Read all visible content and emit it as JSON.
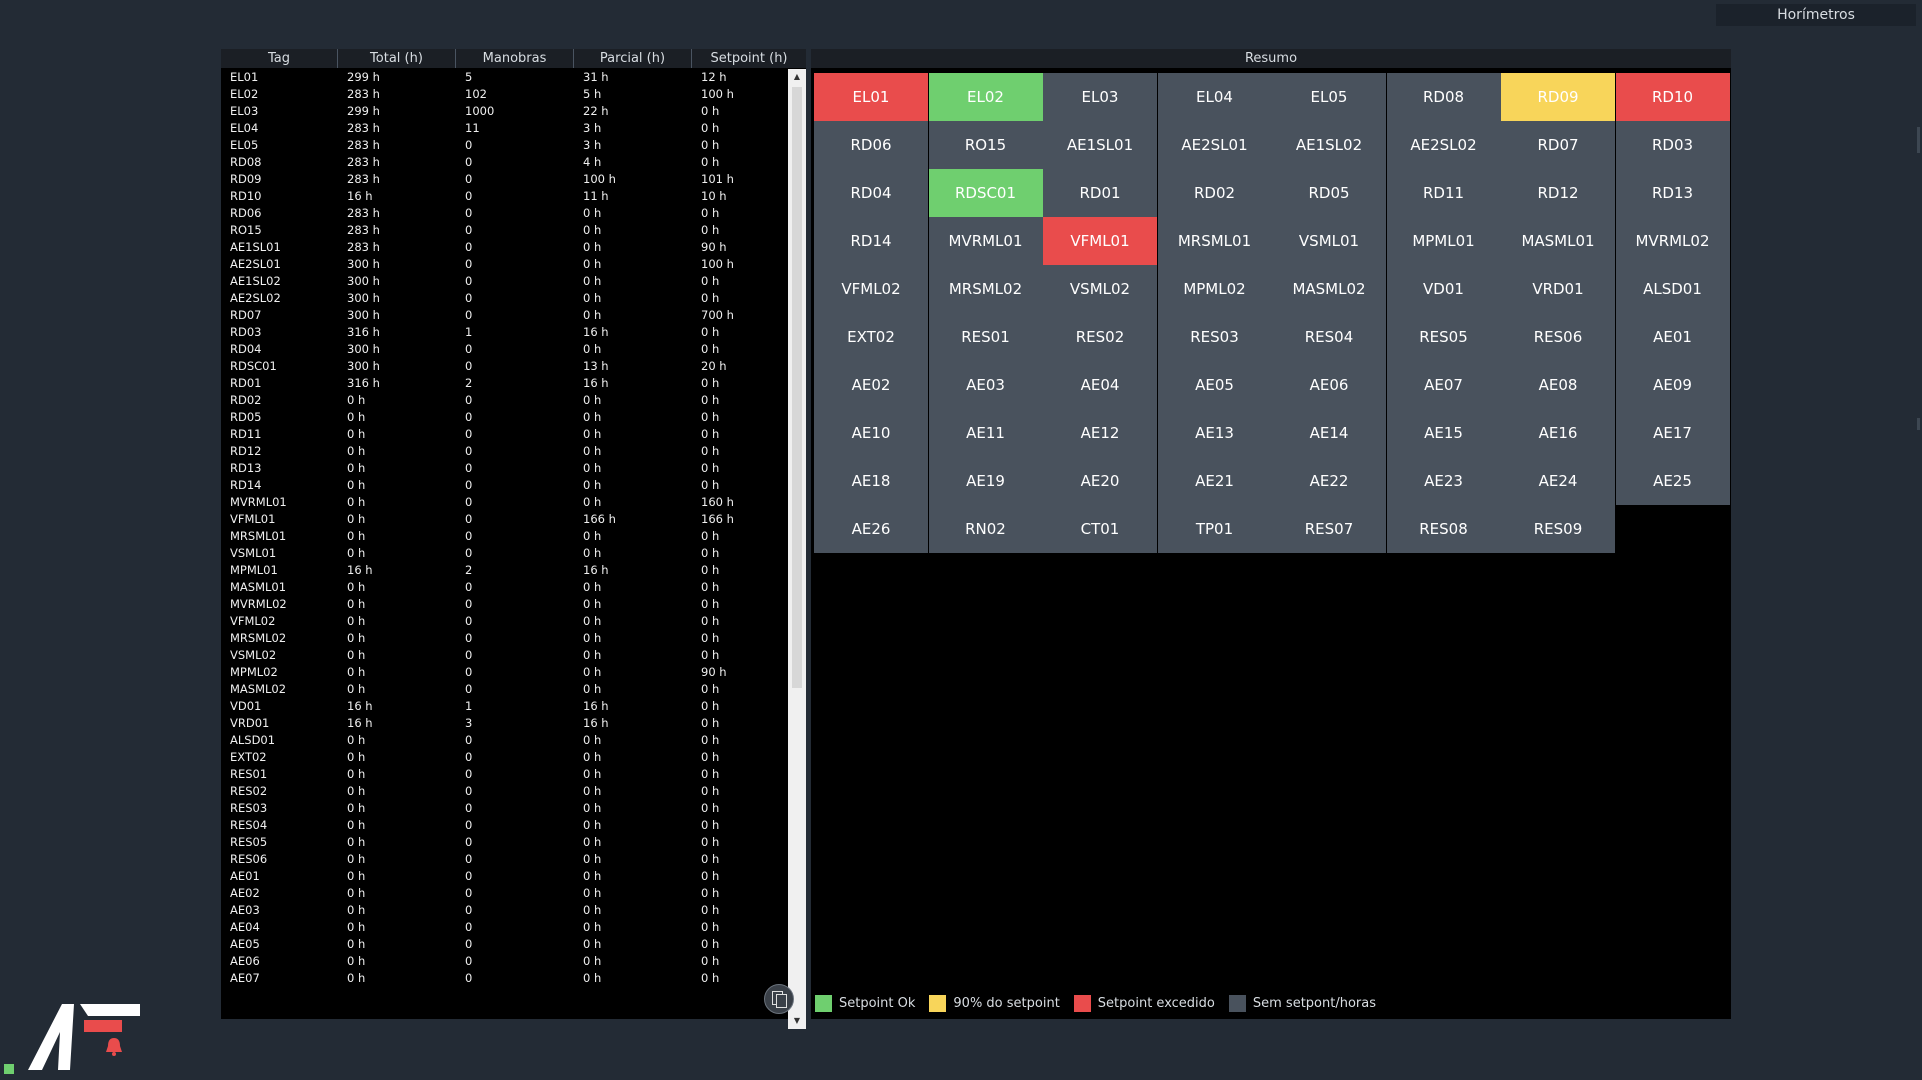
{
  "window": {
    "title": "Horímetros"
  },
  "colors": {
    "ok": "#6fcf6f",
    "warn": "#f8d55a",
    "exceeded": "#e94c4c",
    "none": "#49525d"
  },
  "table": {
    "headers": [
      "Tag",
      "Total (h)",
      "Manobras",
      "Parcial (h)",
      "Setpoint (h)"
    ],
    "rows": [
      [
        "EL01",
        "299 h",
        "5",
        "31 h",
        "12 h"
      ],
      [
        "EL02",
        "283 h",
        "102",
        "5 h",
        "100 h"
      ],
      [
        "EL03",
        "299 h",
        "1000",
        "22 h",
        "0 h"
      ],
      [
        "EL04",
        "283 h",
        "11",
        "3 h",
        "0 h"
      ],
      [
        "EL05",
        "283 h",
        "0",
        "3 h",
        "0 h"
      ],
      [
        "RD08",
        "283 h",
        "0",
        "4 h",
        "0 h"
      ],
      [
        "RD09",
        "283 h",
        "0",
        "100 h",
        "101 h"
      ],
      [
        "RD10",
        "16 h",
        "0",
        "11 h",
        "10 h"
      ],
      [
        "RD06",
        "283 h",
        "0",
        "0 h",
        "0 h"
      ],
      [
        "RO15",
        "283 h",
        "0",
        "0 h",
        "0 h"
      ],
      [
        "AE1SL01",
        "283 h",
        "0",
        "0 h",
        "90 h"
      ],
      [
        "AE2SL01",
        "300 h",
        "0",
        "0 h",
        "100 h"
      ],
      [
        "AE1SL02",
        "300 h",
        "0",
        "0 h",
        "0 h"
      ],
      [
        "AE2SL02",
        "300 h",
        "0",
        "0 h",
        "0 h"
      ],
      [
        "RD07",
        "300 h",
        "0",
        "0 h",
        "700 h"
      ],
      [
        "RD03",
        "316 h",
        "1",
        "16 h",
        "0 h"
      ],
      [
        "RD04",
        "300 h",
        "0",
        "0 h",
        "0 h"
      ],
      [
        "RDSC01",
        "300 h",
        "0",
        "13 h",
        "20 h"
      ],
      [
        "RD01",
        "316 h",
        "2",
        "16 h",
        "0 h"
      ],
      [
        "RD02",
        "0 h",
        "0",
        "0 h",
        "0 h"
      ],
      [
        "RD05",
        "0 h",
        "0",
        "0 h",
        "0 h"
      ],
      [
        "RD11",
        "0 h",
        "0",
        "0 h",
        "0 h"
      ],
      [
        "RD12",
        "0 h",
        "0",
        "0 h",
        "0 h"
      ],
      [
        "RD13",
        "0 h",
        "0",
        "0 h",
        "0 h"
      ],
      [
        "RD14",
        "0 h",
        "0",
        "0 h",
        "0 h"
      ],
      [
        "MVRML01",
        "0 h",
        "0",
        "0 h",
        "160 h"
      ],
      [
        "VFML01",
        "0 h",
        "0",
        "166 h",
        "166 h"
      ],
      [
        "MRSML01",
        "0 h",
        "0",
        "0 h",
        "0 h"
      ],
      [
        "VSML01",
        "0 h",
        "0",
        "0 h",
        "0 h"
      ],
      [
        "MPML01",
        "16 h",
        "2",
        "16 h",
        "0 h"
      ],
      [
        "MASML01",
        "0 h",
        "0",
        "0 h",
        "0 h"
      ],
      [
        "MVRML02",
        "0 h",
        "0",
        "0 h",
        "0 h"
      ],
      [
        "VFML02",
        "0 h",
        "0",
        "0 h",
        "0 h"
      ],
      [
        "MRSML02",
        "0 h",
        "0",
        "0 h",
        "0 h"
      ],
      [
        "VSML02",
        "0 h",
        "0",
        "0 h",
        "0 h"
      ],
      [
        "MPML02",
        "0 h",
        "0",
        "0 h",
        "90 h"
      ],
      [
        "MASML02",
        "0 h",
        "0",
        "0 h",
        "0 h"
      ],
      [
        "VD01",
        "16 h",
        "1",
        "16 h",
        "0 h"
      ],
      [
        "VRD01",
        "16 h",
        "3",
        "16 h",
        "0 h"
      ],
      [
        "ALSD01",
        "0 h",
        "0",
        "0 h",
        "0 h"
      ],
      [
        "EXT02",
        "0 h",
        "0",
        "0 h",
        "0 h"
      ],
      [
        "RES01",
        "0 h",
        "0",
        "0 h",
        "0 h"
      ],
      [
        "RES02",
        "0 h",
        "0",
        "0 h",
        "0 h"
      ],
      [
        "RES03",
        "0 h",
        "0",
        "0 h",
        "0 h"
      ],
      [
        "RES04",
        "0 h",
        "0",
        "0 h",
        "0 h"
      ],
      [
        "RES05",
        "0 h",
        "0",
        "0 h",
        "0 h"
      ],
      [
        "RES06",
        "0 h",
        "0",
        "0 h",
        "0 h"
      ],
      [
        "AE01",
        "0 h",
        "0",
        "0 h",
        "0 h"
      ],
      [
        "AE02",
        "0 h",
        "0",
        "0 h",
        "0 h"
      ],
      [
        "AE03",
        "0 h",
        "0",
        "0 h",
        "0 h"
      ],
      [
        "AE04",
        "0 h",
        "0",
        "0 h",
        "0 h"
      ],
      [
        "AE05",
        "0 h",
        "0",
        "0 h",
        "0 h"
      ],
      [
        "AE06",
        "0 h",
        "0",
        "0 h",
        "0 h"
      ],
      [
        "AE07",
        "0 h",
        "0",
        "0 h",
        "0 h"
      ]
    ],
    "copy_icon": "copy-icon",
    "scroll_icons": [
      "scroll-up-icon",
      "scroll-down-icon"
    ]
  },
  "summary": {
    "title": "Resumo",
    "columns": 8,
    "tiles": [
      {
        "label": "EL01",
        "status": "exceeded"
      },
      {
        "label": "EL02",
        "status": "ok"
      },
      {
        "label": "EL03",
        "status": "none"
      },
      {
        "label": "EL04",
        "status": "none"
      },
      {
        "label": "EL05",
        "status": "none"
      },
      {
        "label": "RD08",
        "status": "none"
      },
      {
        "label": "RD09",
        "status": "warn"
      },
      {
        "label": "RD10",
        "status": "exceeded"
      },
      {
        "label": "RD06",
        "status": "none"
      },
      {
        "label": "RO15",
        "status": "none"
      },
      {
        "label": "AE1SL01",
        "status": "none"
      },
      {
        "label": "AE2SL01",
        "status": "none"
      },
      {
        "label": "AE1SL02",
        "status": "none"
      },
      {
        "label": "AE2SL02",
        "status": "none"
      },
      {
        "label": "RD07",
        "status": "none"
      },
      {
        "label": "RD03",
        "status": "none"
      },
      {
        "label": "RD04",
        "status": "none"
      },
      {
        "label": "RDSC01",
        "status": "ok"
      },
      {
        "label": "RD01",
        "status": "none"
      },
      {
        "label": "RD02",
        "status": "none"
      },
      {
        "label": "RD05",
        "status": "none"
      },
      {
        "label": "RD11",
        "status": "none"
      },
      {
        "label": "RD12",
        "status": "none"
      },
      {
        "label": "RD13",
        "status": "none"
      },
      {
        "label": "RD14",
        "status": "none"
      },
      {
        "label": "MVRML01",
        "status": "none"
      },
      {
        "label": "VFML01",
        "status": "exceeded"
      },
      {
        "label": "MRSML01",
        "status": "none"
      },
      {
        "label": "VSML01",
        "status": "none"
      },
      {
        "label": "MPML01",
        "status": "none"
      },
      {
        "label": "MASML01",
        "status": "none"
      },
      {
        "label": "MVRML02",
        "status": "none"
      },
      {
        "label": "VFML02",
        "status": "none"
      },
      {
        "label": "MRSML02",
        "status": "none"
      },
      {
        "label": "VSML02",
        "status": "none"
      },
      {
        "label": "MPML02",
        "status": "none"
      },
      {
        "label": "MASML02",
        "status": "none"
      },
      {
        "label": "VD01",
        "status": "none"
      },
      {
        "label": "VRD01",
        "status": "none"
      },
      {
        "label": "ALSD01",
        "status": "none"
      },
      {
        "label": "EXT02",
        "status": "none"
      },
      {
        "label": "RES01",
        "status": "none"
      },
      {
        "label": "RES02",
        "status": "none"
      },
      {
        "label": "RES03",
        "status": "none"
      },
      {
        "label": "RES04",
        "status": "none"
      },
      {
        "label": "RES05",
        "status": "none"
      },
      {
        "label": "RES06",
        "status": "none"
      },
      {
        "label": "AE01",
        "status": "none"
      },
      {
        "label": "AE02",
        "status": "none"
      },
      {
        "label": "AE03",
        "status": "none"
      },
      {
        "label": "AE04",
        "status": "none"
      },
      {
        "label": "AE05",
        "status": "none"
      },
      {
        "label": "AE06",
        "status": "none"
      },
      {
        "label": "AE07",
        "status": "none"
      },
      {
        "label": "AE08",
        "status": "none"
      },
      {
        "label": "AE09",
        "status": "none"
      },
      {
        "label": "AE10",
        "status": "none"
      },
      {
        "label": "AE11",
        "status": "none"
      },
      {
        "label": "AE12",
        "status": "none"
      },
      {
        "label": "AE13",
        "status": "none"
      },
      {
        "label": "AE14",
        "status": "none"
      },
      {
        "label": "AE15",
        "status": "none"
      },
      {
        "label": "AE16",
        "status": "none"
      },
      {
        "label": "AE17",
        "status": "none"
      },
      {
        "label": "AE18",
        "status": "none"
      },
      {
        "label": "AE19",
        "status": "none"
      },
      {
        "label": "AE20",
        "status": "none"
      },
      {
        "label": "AE21",
        "status": "none"
      },
      {
        "label": "AE22",
        "status": "none"
      },
      {
        "label": "AE23",
        "status": "none"
      },
      {
        "label": "AE24",
        "status": "none"
      },
      {
        "label": "AE25",
        "status": "none"
      },
      {
        "label": "AE26",
        "status": "none"
      },
      {
        "label": "RN02",
        "status": "none"
      },
      {
        "label": "CT01",
        "status": "none"
      },
      {
        "label": "TP01",
        "status": "none"
      },
      {
        "label": "RES07",
        "status": "none"
      },
      {
        "label": "RES08",
        "status": "none"
      },
      {
        "label": "RES09",
        "status": "none"
      }
    ],
    "legend": [
      {
        "label": "Setpoint Ok",
        "status": "ok"
      },
      {
        "label": "90% do setpoint",
        "status": "warn"
      },
      {
        "label": "Setpoint excedido",
        "status": "exceeded"
      },
      {
        "label": "Sem setpont/horas",
        "status": "none"
      }
    ]
  },
  "status": {
    "indicator_color": "#6fcf6f"
  },
  "logo": {
    "icon": "company-logo-icon",
    "alarm_icon": "alarm-bell-icon"
  }
}
